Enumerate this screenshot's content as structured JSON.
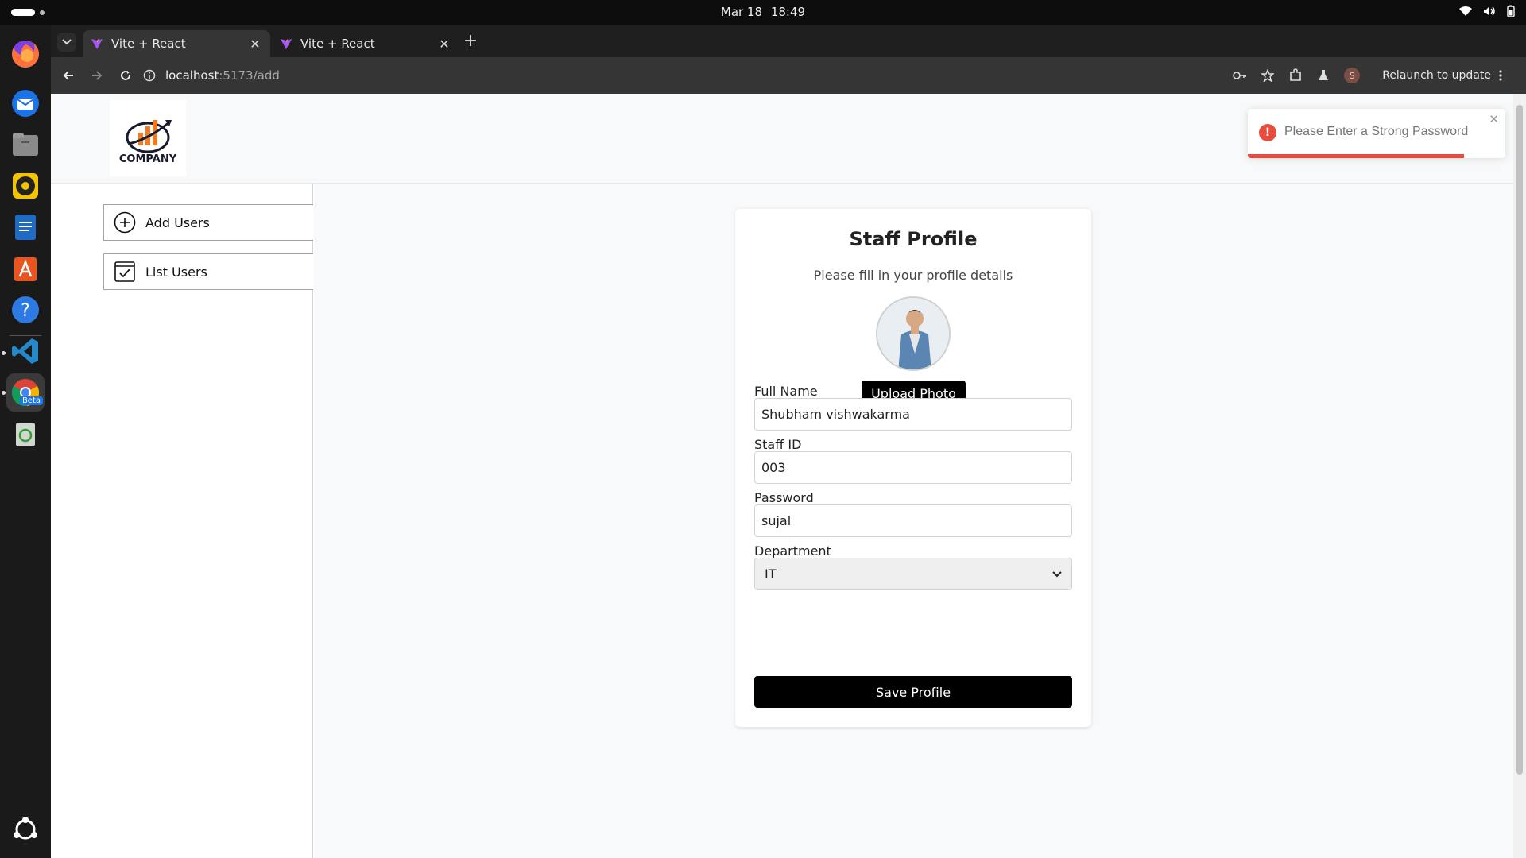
{
  "system": {
    "date": "Mar 18",
    "time": "18:49"
  },
  "dock": {
    "apps": [
      "firefox-icon",
      "thunderbird-icon",
      "files-icon",
      "rhythmbox-icon",
      "writer-icon",
      "app-center-icon",
      "help-icon",
      "vscode-icon",
      "chrome-beta-icon",
      "trash-icon",
      "show-apps-icon"
    ],
    "chrome_badge": "Beta"
  },
  "browser": {
    "tabs": [
      {
        "title": "Vite + React",
        "active": true
      },
      {
        "title": "Vite + React",
        "active": false
      }
    ],
    "url_host": "localhost",
    "url_rest": ":5173/add",
    "profile_initial": "S",
    "relaunch_label": "Relaunch to update"
  },
  "app": {
    "logo_text": "COMPANY",
    "sidebar": {
      "items": [
        {
          "label": "Add Users",
          "icon": "plus-circle-icon"
        },
        {
          "label": "List Users",
          "icon": "checkbox-list-icon"
        }
      ]
    },
    "form": {
      "title": "Staff Profile",
      "subtitle": "Please fill in your profile details",
      "upload_label": "Upload Photo",
      "full_name_label": "Full Name",
      "full_name_value": "Shubham vishwakarma",
      "staff_id_label": "Staff ID",
      "staff_id_value": "003",
      "password_label": "Password",
      "password_value": "sujal",
      "department_label": "Department",
      "department_value": "IT",
      "save_label": "Save Profile"
    },
    "toast": {
      "message": "Please Enter a Strong Password",
      "progress": 0.84,
      "color": "#e74c3c"
    }
  }
}
